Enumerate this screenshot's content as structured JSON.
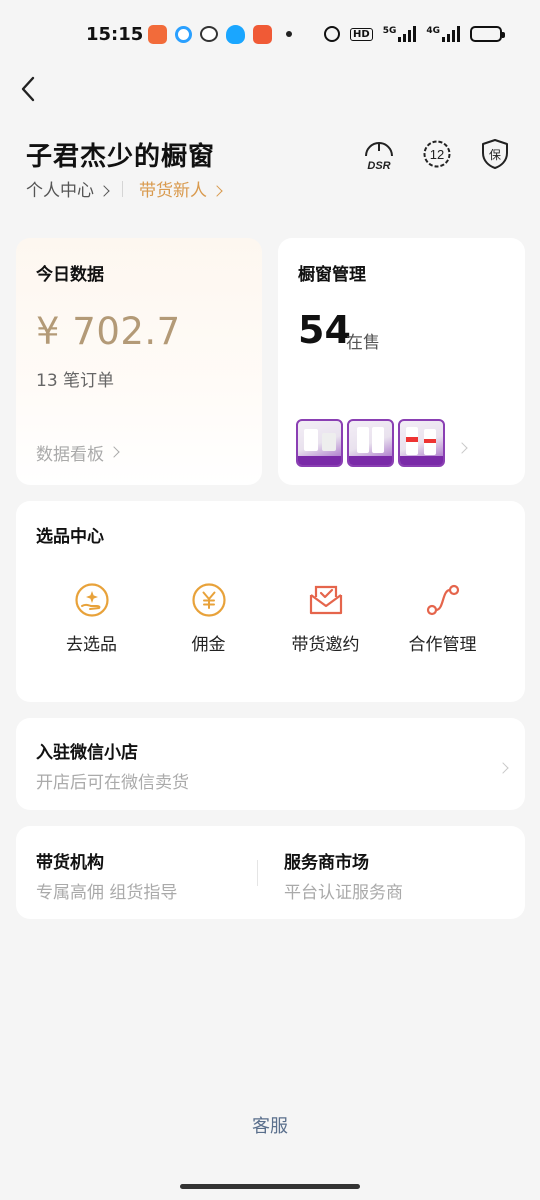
{
  "status_bar": {
    "time": "15:15",
    "hd_label": "HD",
    "net_5g": "5G",
    "net_4g": "4G",
    "battery_level": 0.45
  },
  "header": {
    "shop_title": "子君杰少的橱窗",
    "link_personal": "个人中心",
    "link_new_seller": "带货新人",
    "icon_dsr_label": "DSR",
    "icon_level_label": "12",
    "icon_guarantee_label": "保"
  },
  "today": {
    "title": "今日数据",
    "amount": "¥ 702.7",
    "orders": "13 笔订单",
    "board_link": "数据看板"
  },
  "window": {
    "title": "橱窗管理",
    "count": "54",
    "count_label": "在售"
  },
  "select_center": {
    "title": "选品中心",
    "items": [
      {
        "label": "去选品",
        "icon": "hand-star-icon"
      },
      {
        "label": "佣金",
        "icon": "yen-coin-icon"
      },
      {
        "label": "带货邀约",
        "icon": "invitation-envelope-icon"
      },
      {
        "label": "合作管理",
        "icon": "cooperation-path-icon"
      }
    ]
  },
  "wechat": {
    "title": "入驻微信小店",
    "subtitle": "开店后可在微信卖货"
  },
  "org": {
    "title": "带货机构",
    "subtitle": "专属高佣 组货指导"
  },
  "service_market": {
    "title": "服务商市场",
    "subtitle": "平台认证服务商"
  },
  "footer": {
    "service_link": "客服"
  },
  "colors": {
    "accent_gold": "#d99a4e",
    "amount_gold": "#b39a77",
    "icon_orange": "#e8a23a",
    "icon_red": "#e5654c",
    "service_blue": "#5a6f8c"
  }
}
